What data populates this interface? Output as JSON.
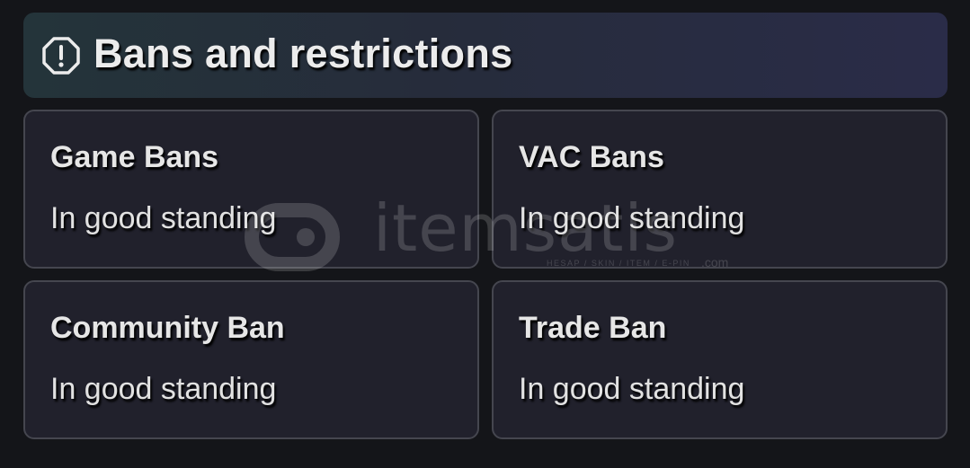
{
  "header": {
    "title": "Bans and restrictions",
    "icon": "alert-octagon-icon"
  },
  "cards": [
    {
      "title": "Game Bans",
      "status": "In good standing"
    },
    {
      "title": "VAC Bans",
      "status": "In good standing"
    },
    {
      "title": "Community Ban",
      "status": "In good standing"
    },
    {
      "title": "Trade Ban",
      "status": "In good standing"
    }
  ],
  "watermark": {
    "brand": "itemsatis",
    "tagline": "HESAP / SKIN / ITEM / E-PIN",
    "domain": ".com"
  },
  "colors": {
    "background": "#141519",
    "card_background": "#21212c",
    "card_border": "#45464f",
    "text": "#e6e6e6"
  }
}
